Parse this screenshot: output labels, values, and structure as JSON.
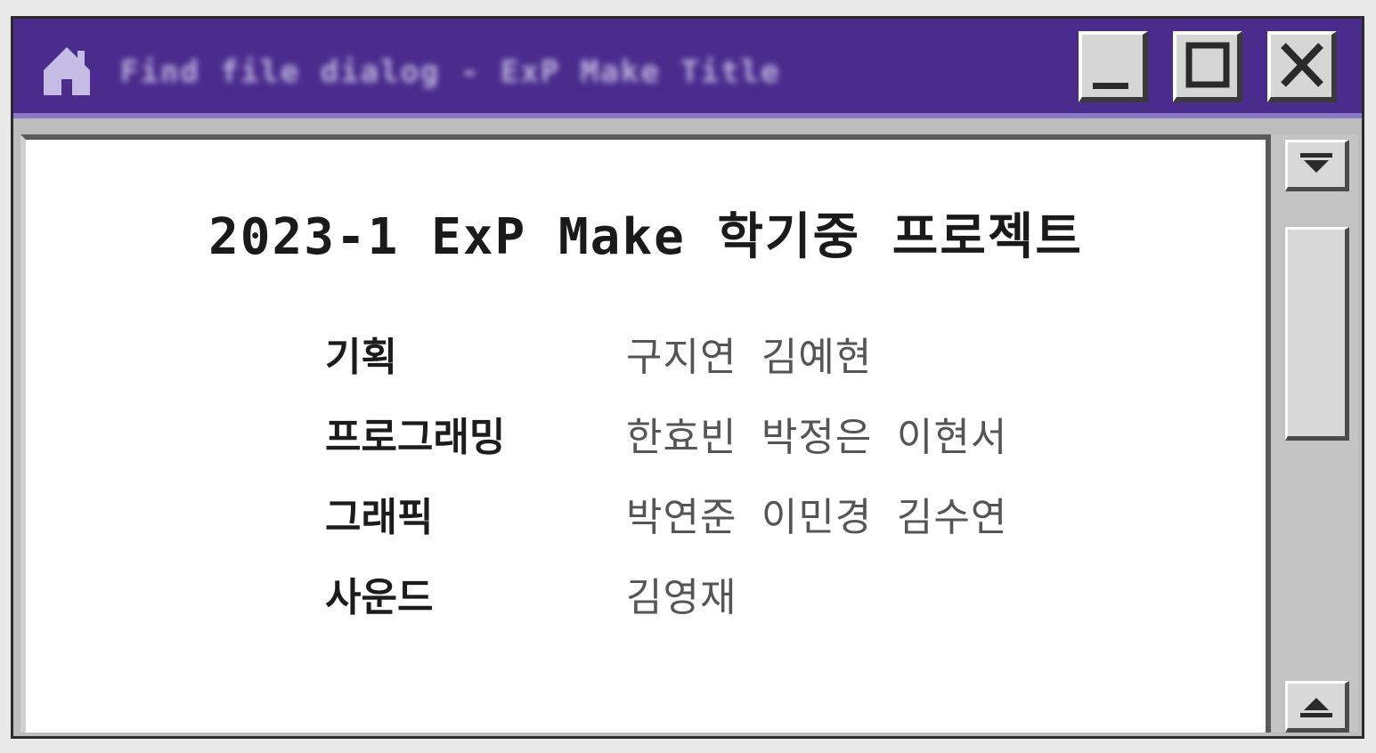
{
  "window": {
    "title": "Find file dialog - ExP Make Title",
    "icon": "home-icon",
    "controls": {
      "minimize_icon": "minimize-icon",
      "maximize_icon": "maximize-icon",
      "close_icon": "close-icon"
    },
    "colors": {
      "titlebar": "#4a2c8c",
      "titlebar_accent": "#8a79c4",
      "content_bg": "#ffffff"
    }
  },
  "content": {
    "heading": "2023-1 ExP Make 학기중 프로젝트",
    "credits": [
      {
        "role": "기획",
        "names": "구지연 김예현"
      },
      {
        "role": "프로그래밍",
        "names": "한효빈 박정은 이현서"
      },
      {
        "role": "그래픽",
        "names": "박연준 이민경 김수연"
      },
      {
        "role": "사운드",
        "names": "김영재"
      }
    ]
  },
  "scrollbar": {
    "up_icon": "scroll-up-arrow-icon",
    "down_icon": "scroll-down-arrow-icon"
  }
}
